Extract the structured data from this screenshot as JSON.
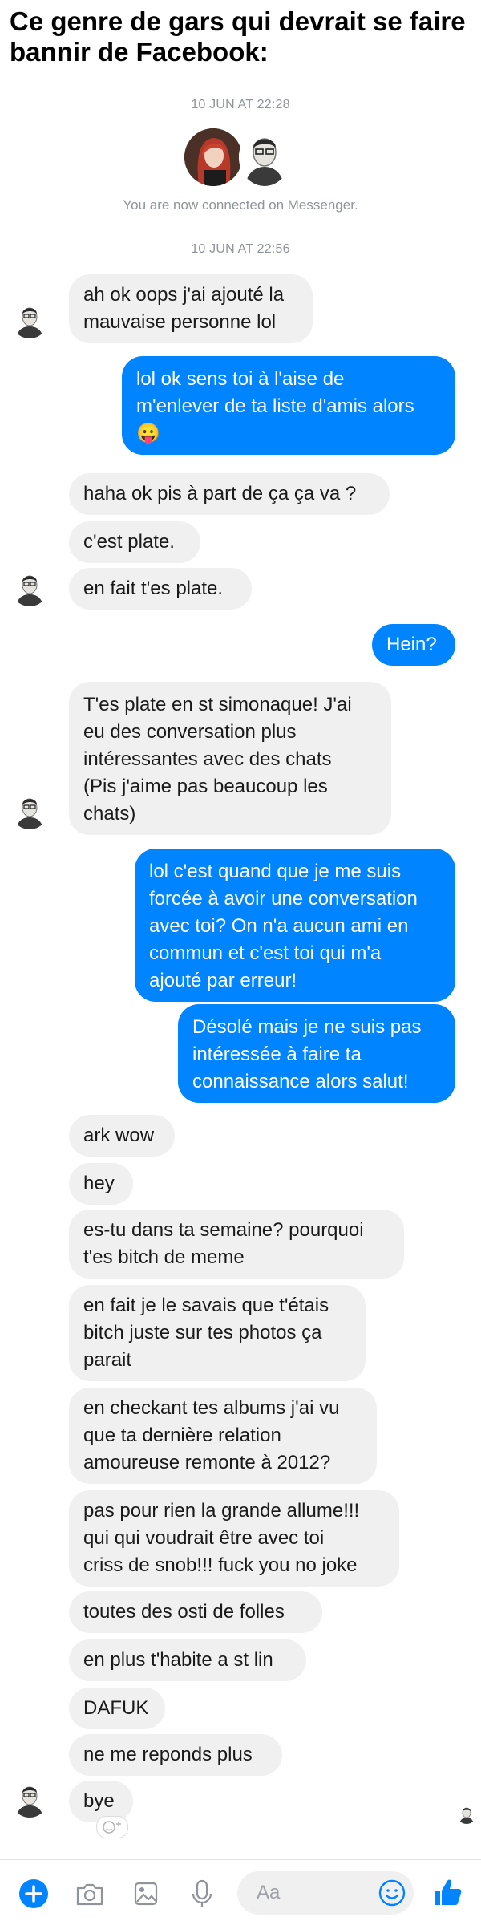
{
  "caption": "Ce genre de gars qui devrait se faire bannir de Facebook:",
  "timestamps": [
    "10 JUN AT 22:28",
    "10 JUN AT 22:56"
  ],
  "connected_text": "You are now connected on Messenger.",
  "messages": [
    {
      "side": "in",
      "text": "ah ok oops j'ai ajouté la\nmauvaise personne lol"
    },
    {
      "side": "out",
      "text": "lol ok sens toi à l'aise de\nm'enlever de ta liste d'amis alors\n😛"
    },
    {
      "side": "in",
      "text": "haha ok pis à part de ça ça va ?"
    },
    {
      "side": "in",
      "text": "c'est plate."
    },
    {
      "side": "in",
      "text": "en fait t'es plate."
    },
    {
      "side": "out",
      "text": "Hein?"
    },
    {
      "side": "in",
      "text": "T'es plate en st simonaque! J'ai\neu des conversation plus\nintéressantes avec des chats\n(Pis j'aime pas beaucoup les\nchats)"
    },
    {
      "side": "out",
      "text": "lol c'est quand que je me suis\nforcée à avoir une conversation\navec toi? On n'a aucun ami en\ncommun et c'est toi qui m'a\najouté par erreur!"
    },
    {
      "side": "out",
      "text": "Désolé mais je ne suis pas\nintéressée à faire ta\nconnaissance alors salut!"
    },
    {
      "side": "in",
      "text": "ark wow"
    },
    {
      "side": "in",
      "text": "hey"
    },
    {
      "side": "in",
      "text": "es-tu dans ta semaine? pourquoi\nt'es bitch de meme"
    },
    {
      "side": "in",
      "text": "en fait je le savais que t'étais\nbitch juste sur tes photos ça\nparait"
    },
    {
      "side": "in",
      "text": "en checkant tes albums j'ai vu\nque ta dernière relation\namoureuse remonte à 2012?"
    },
    {
      "side": "in",
      "text": "pas pour rien la grande allume!!!\nqui qui voudrait être avec toi\ncriss de snob!!! fuck you no joke"
    },
    {
      "side": "in",
      "text": "toutes des osti de folles"
    },
    {
      "side": "in",
      "text": "en plus t'habite a st lin"
    },
    {
      "side": "in",
      "text": "DAFUK"
    },
    {
      "side": "in",
      "text": "ne me reponds plus"
    },
    {
      "side": "in",
      "text": "bye"
    }
  ],
  "composer": {
    "placeholder": "Aa",
    "icons": [
      "plus-icon",
      "camera-icon",
      "image-icon",
      "microphone-icon",
      "emoji-icon",
      "thumbs-up-icon"
    ]
  },
  "colors": {
    "outgoing": "#0084ff",
    "incoming": "#f1f0f0",
    "timestamp": "#8f949b"
  }
}
